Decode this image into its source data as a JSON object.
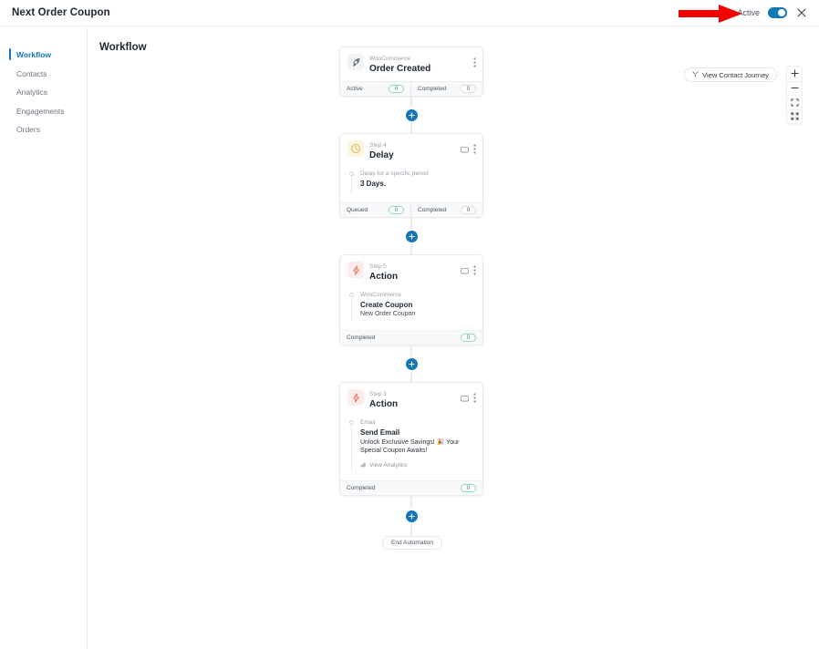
{
  "topbar": {
    "title": "Next Order Coupon",
    "active_label": "Active",
    "toggle_state": "on",
    "close_icon": "close-icon",
    "annotation": {
      "type": "red-arrow",
      "color": "#f40000",
      "points_to": "Active toggle"
    }
  },
  "sidebar": {
    "items": [
      {
        "label": "Workflow",
        "active": true
      },
      {
        "label": "Contacts",
        "active": false
      },
      {
        "label": "Analytics",
        "active": false
      },
      {
        "label": "Engagements",
        "active": false
      },
      {
        "label": "Orders",
        "active": false
      }
    ]
  },
  "canvas": {
    "title": "Workflow",
    "journey_button": {
      "label": "View Contact Journey",
      "icon": "funnel-branch-icon"
    },
    "zoom_controls": [
      {
        "name": "zoom-in",
        "icon": "plus-icon"
      },
      {
        "name": "zoom-out",
        "icon": "minus-icon"
      },
      {
        "name": "fit-view",
        "icon": "fit-corners-icon"
      },
      {
        "name": "full-screen",
        "icon": "expand-corners-icon"
      }
    ]
  },
  "flow": {
    "nodes": [
      {
        "kind": "trigger",
        "icon": "rocket-icon",
        "step": "WooCommerce",
        "title": "Order Created",
        "has_comment_icon": false,
        "body": null,
        "footer": [
          {
            "label": "Active",
            "count": "0",
            "accent": "teal"
          },
          {
            "label": "Completed",
            "count": "0",
            "accent": "gray"
          }
        ]
      },
      {
        "kind": "delay",
        "icon": "clock-icon",
        "step": "Step 4",
        "title": "Delay",
        "has_comment_icon": true,
        "body": {
          "sub": "Delay for a specific period",
          "main": "3 Days.",
          "extra": null,
          "desc": null,
          "analytics": null
        },
        "footer": [
          {
            "label": "Queued",
            "count": "0",
            "accent": "teal"
          },
          {
            "label": "Completed",
            "count": "0",
            "accent": "gray"
          }
        ]
      },
      {
        "kind": "action",
        "icon": "bolt-icon",
        "step": "Step 5",
        "title": "Action",
        "has_comment_icon": true,
        "body": {
          "sub": "WooCommerce",
          "main": "Create Coupon",
          "extra": "New Order Coupon",
          "desc": null,
          "analytics": null
        },
        "footer": [
          {
            "label": "Completed",
            "count": "0",
            "accent": "teal"
          }
        ]
      },
      {
        "kind": "action",
        "icon": "bolt-icon",
        "step": "Step 3",
        "title": "Action",
        "has_comment_icon": true,
        "body": {
          "sub": "Email",
          "main": "Send Email",
          "extra": null,
          "desc": "Unlock Exclusive Savings! 🎉 Your Special Coupon Awaits!",
          "analytics": "View Analytics"
        },
        "footer": [
          {
            "label": "Completed",
            "count": "0",
            "accent": "teal"
          }
        ]
      }
    ],
    "end_node_label": "End Automation",
    "add_button_icon": "plus-icon"
  },
  "colors": {
    "accent_blue": "#1477b8",
    "teal_badge": "#8fd9c4",
    "delay_amber": "#e8a93c",
    "action_red": "#e8604c",
    "annotation_red": "#f40000"
  }
}
